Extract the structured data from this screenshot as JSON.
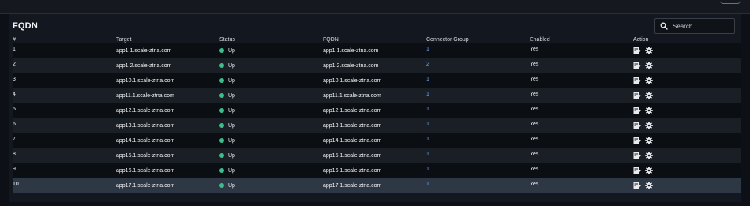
{
  "panel": {
    "title": "FQDN"
  },
  "search": {
    "placeholder": "Search"
  },
  "table": {
    "headers": [
      "#",
      "Target",
      "Status",
      "FQDN",
      "Connector Group",
      "Enabled",
      "Action"
    ],
    "rows": [
      {
        "num": "1",
        "target": "app1.1.scale-ztna.com",
        "status": "Up",
        "fqdn": "app1.1.scale-ztna.com",
        "group": "1",
        "enabled": "Yes"
      },
      {
        "num": "2",
        "target": "app1.2.scale-ztna.com",
        "status": "Up",
        "fqdn": "app1.2.scale-ztna.com",
        "group": "2",
        "enabled": "Yes"
      },
      {
        "num": "3",
        "target": "app10.1.scale-ztna.com",
        "status": "Up",
        "fqdn": "app10.1.scale-ztna.com",
        "group": "1",
        "enabled": "Yes"
      },
      {
        "num": "4",
        "target": "app11.1.scale-ztna.com",
        "status": "Up",
        "fqdn": "app11.1.scale-ztna.com",
        "group": "1",
        "enabled": "Yes"
      },
      {
        "num": "5",
        "target": "app12.1.scale-ztna.com",
        "status": "Up",
        "fqdn": "app12.1.scale-ztna.com",
        "group": "1",
        "enabled": "Yes"
      },
      {
        "num": "6",
        "target": "app13.1.scale-ztna.com",
        "status": "Up",
        "fqdn": "app13.1.scale-ztna.com",
        "group": "1",
        "enabled": "Yes"
      },
      {
        "num": "7",
        "target": "app14.1.scale-ztna.com",
        "status": "Up",
        "fqdn": "app14.1.scale-ztna.com",
        "group": "1",
        "enabled": "Yes"
      },
      {
        "num": "8",
        "target": "app15.1.scale-ztna.com",
        "status": "Up",
        "fqdn": "app15.1.scale-ztna.com",
        "group": "1",
        "enabled": "Yes"
      },
      {
        "num": "9",
        "target": "app16.1.scale-ztna.com",
        "status": "Up",
        "fqdn": "app16.1.scale-ztna.com",
        "group": "1",
        "enabled": "Yes"
      },
      {
        "num": "10",
        "target": "app17.1.scale-ztna.com",
        "status": "Up",
        "fqdn": "app17.1.scale-ztna.com",
        "group": "1",
        "enabled": "Yes"
      }
    ]
  },
  "colors": {
    "status_up": "#3dbc8c",
    "link": "#6fa8ff",
    "selected_row": "#2e3744"
  },
  "icons": {
    "search": "search-icon",
    "edit": "edit-icon",
    "settings": "gear-icon"
  }
}
